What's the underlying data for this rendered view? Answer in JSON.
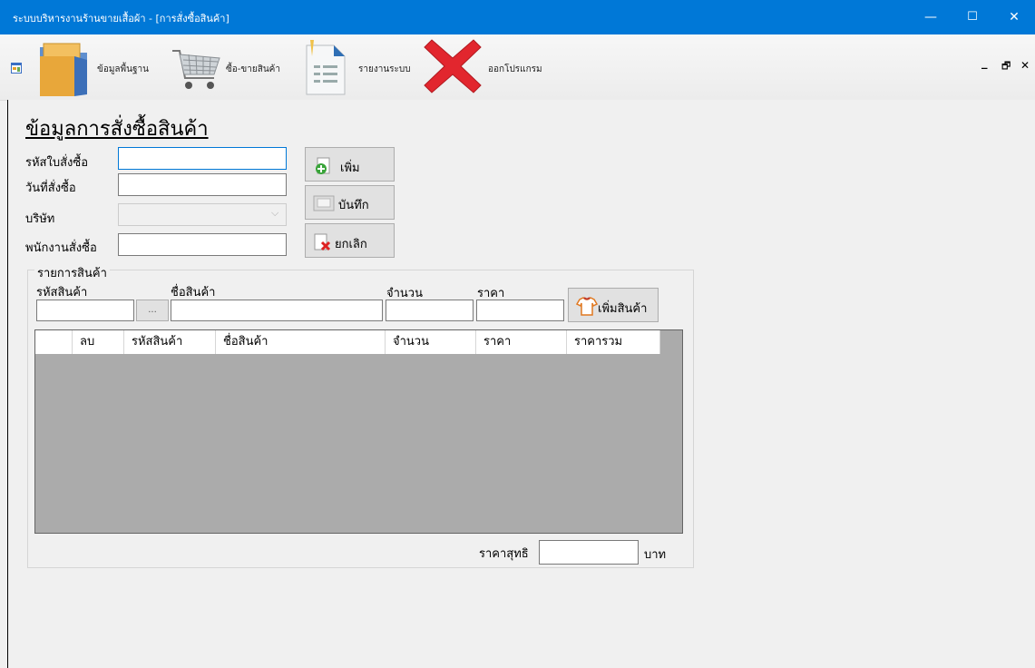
{
  "window": {
    "title": "ระบบบริหารงานร้านขายเสื้อผ้า - [การสั่งซื้อสินค้า]",
    "minimize": "—",
    "maximize": "☐",
    "close": "✕"
  },
  "toolbar": {
    "items": [
      {
        "label": "ข้อมูลพื้นฐาน",
        "icon": "folder-icon"
      },
      {
        "label": "ซื้อ-ขายสินค้า",
        "icon": "shopping-cart-icon"
      },
      {
        "label": "รายงานระบบ",
        "icon": "report-document-icon"
      },
      {
        "label": "ออกโปรแกรม",
        "icon": "red-x-exit-icon"
      }
    ],
    "mdi_minimize": "_",
    "mdi_restore": "🗗",
    "mdi_close": "✕"
  },
  "form": {
    "heading": "ข้อมูลการสั่งซื้อสินค้า",
    "order_id_label": "รหัสใบสั่งซื้อ",
    "order_id_value": "",
    "order_date_label": "วันที่สั่งซื้อ",
    "order_date_value": "",
    "company_label": "บริษัท",
    "company_value": "",
    "employee_label": "พนักงานสั่งซื้อ",
    "employee_value": "",
    "add_button": "เพิ่ม",
    "save_button": "บันทึก",
    "cancel_button": "ยกเลิก"
  },
  "items_group": {
    "title": "รายการสินค้า",
    "product_id_label": "รหัสสินค้า",
    "product_name_label": "ชื่อสินค้า",
    "qty_label": "จำนวน",
    "price_label": "ราคา",
    "browse_button": "...",
    "add_product_button": "เพิ่มสินค้า",
    "grid_columns": [
      "",
      "ลบ",
      "รหัสสินค้า",
      "ชื่อสินค้า",
      "จำนวน",
      "ราคา",
      "ราคารวม"
    ],
    "net_price_label": "ราคาสุทธิ",
    "net_price_value": "",
    "currency": "บาท"
  },
  "colors": {
    "titlebar": "#0078d7",
    "grid_bg": "#ababab",
    "window_bg": "#f0f0f0"
  }
}
